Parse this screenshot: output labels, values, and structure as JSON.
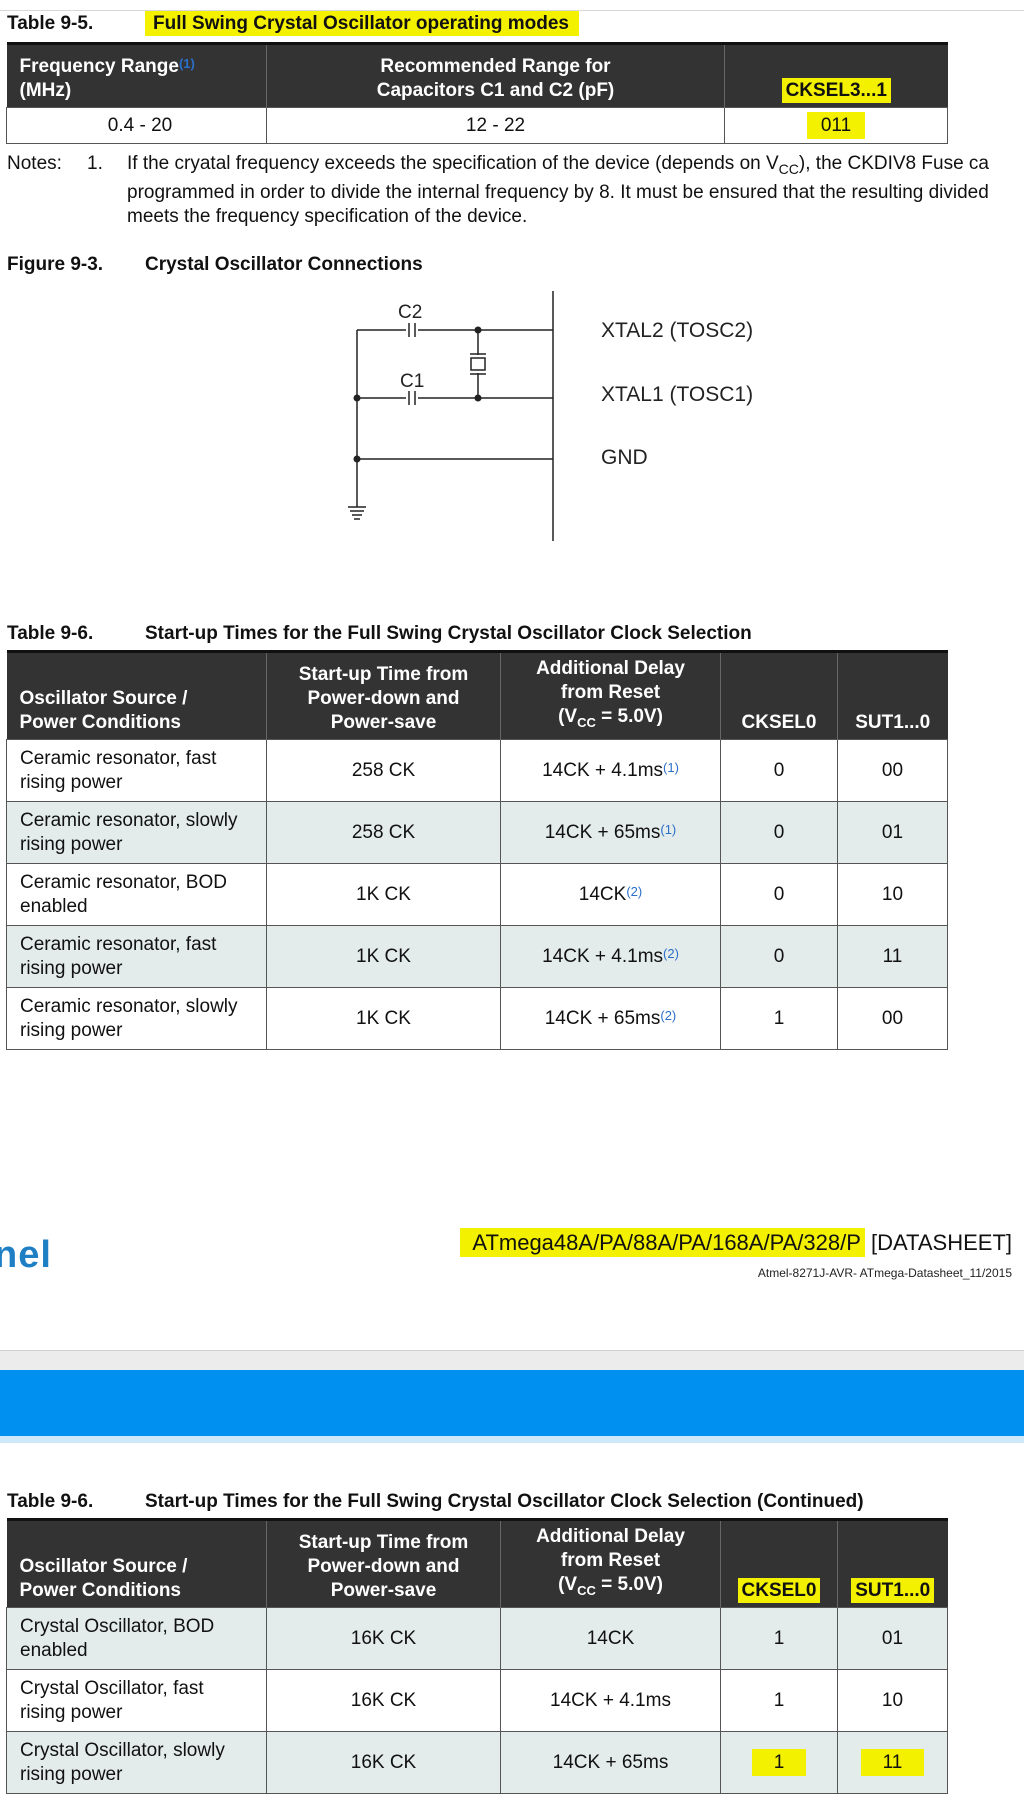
{
  "table95": {
    "number": "Table 9-5.",
    "title": "Full Swing Crystal Oscillator operating modes",
    "headers": {
      "freq_line1": "Frequency Range",
      "freq_note": "(1)",
      "freq_line2": "(MHz)",
      "cap_line1": "Recommended Range for",
      "cap_line2": "Capacitors C1 and C2 (pF)",
      "cksel": "CKSEL3...1"
    },
    "row": {
      "freq": "0.4 - 20",
      "cap": "12 - 22",
      "cksel": "011"
    }
  },
  "notes": {
    "label": "Notes:",
    "number": "1.",
    "line1_a": "If the cryatal frequency exceeds the specification of the device (depends on V",
    "line1_sub": "CC",
    "line1_b": "), the CKDIV8 Fuse ca",
    "line2": "programmed in order to divide the internal frequency by 8. It must be ensured that the resulting divided",
    "line3": "meets the frequency specification of the device."
  },
  "figure93": {
    "number": "Figure 9-3.",
    "title": "Crystal Oscillator Connections",
    "labels": {
      "c2": "C2",
      "c1": "C1",
      "xtal2": "XTAL2 (TOSC2)",
      "xtal1": "XTAL1 (TOSC1)",
      "gnd": "GND"
    }
  },
  "table96": {
    "number": "Table 9-6.",
    "title": "Start-up Times for the Full Swing Crystal Oscillator Clock Selection",
    "headers": {
      "source_l1": "Oscillator Source /",
      "source_l2": "Power Conditions",
      "startup_l1": "Start-up Time from",
      "startup_l2": "Power-down and",
      "startup_l3": "Power-save",
      "delay_l1": "Additional Delay",
      "delay_l2": "from Reset",
      "delay_l3_a": "(V",
      "delay_l3_sub": "CC",
      "delay_l3_b": " = 5.0V)",
      "cksel0": "CKSEL0",
      "sut": "SUT1...0"
    },
    "rows": [
      {
        "src1": "Ceramic resonator, fast",
        "src2": "rising power",
        "startup": "258 CK",
        "delay": "14CK + 4.1ms",
        "note": "(1)",
        "cksel0": "0",
        "sut": "00"
      },
      {
        "src1": "Ceramic resonator, slowly",
        "src2": "rising power",
        "startup": "258 CK",
        "delay": "14CK + 65ms",
        "note": "(1)",
        "cksel0": "0",
        "sut": "01"
      },
      {
        "src1": "Ceramic resonator, BOD",
        "src2": "enabled",
        "startup": "1K CK",
        "delay": "14CK",
        "note": "(2)",
        "cksel0": "0",
        "sut": "10"
      },
      {
        "src1": "Ceramic resonator, fast",
        "src2": "rising power",
        "startup": "1K CK",
        "delay": "14CK + 4.1ms",
        "note": "(2)",
        "cksel0": "0",
        "sut": "11"
      },
      {
        "src1": "Ceramic resonator, slowly",
        "src2": "rising power",
        "startup": "1K CK",
        "delay": "14CK + 65ms",
        "note": "(2)",
        "cksel0": "1",
        "sut": "00"
      }
    ]
  },
  "footer": {
    "logo": "nel",
    "device": "ATmega48A/PA/88A/PA/168A/PA/328/P",
    "bracket": " [DATASHEET]",
    "docid": "Atmel-8271J-AVR- ATmega-Datasheet_11/2015"
  },
  "table96cont": {
    "number": "Table 9-6.",
    "title": "Start-up Times for the Full Swing Crystal Oscillator Clock Selection (Continued)",
    "rows": [
      {
        "src1": "Crystal Oscillator, BOD",
        "src2": "enabled",
        "startup": "16K CK",
        "delay": "14CK",
        "cksel0": "1",
        "sut": "01"
      },
      {
        "src1": "Crystal Oscillator, fast",
        "src2": "rising power",
        "startup": "16K CK",
        "delay": "14CK + 4.1ms",
        "cksel0": "1",
        "sut": "10"
      },
      {
        "src1": "Crystal Oscillator, slowly",
        "src2": "rising power",
        "startup": "16K CK",
        "delay": "14CK + 65ms",
        "cksel0": "1",
        "sut": "11"
      }
    ]
  },
  "colors": {
    "highlight": "#f3f000",
    "header_bg": "#333333",
    "alt_row": "#e4ebeb",
    "band": "#0090f0",
    "logo": "#1f7fc4"
  }
}
